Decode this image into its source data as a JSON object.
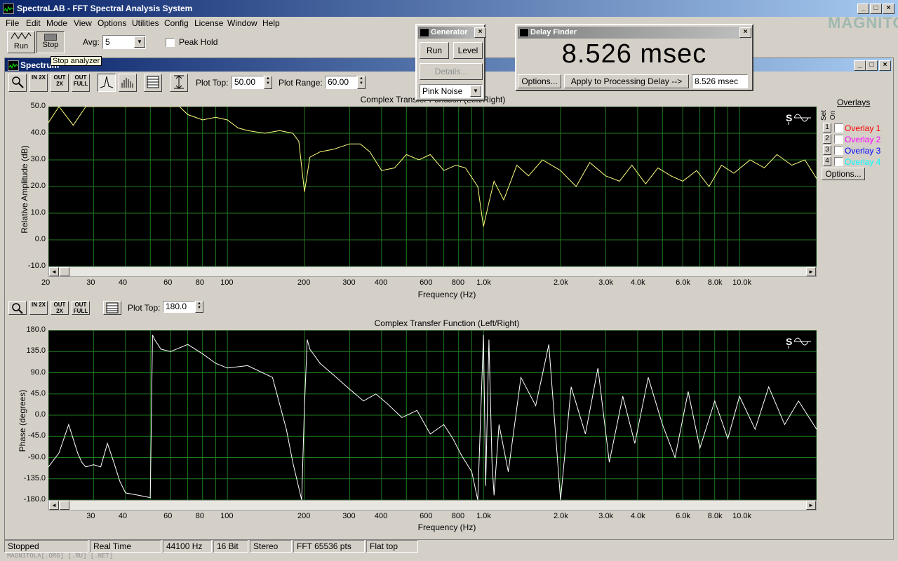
{
  "app": {
    "title": "SpectraLAB - FFT Spectral Analysis System",
    "watermark": "MAGNITOLA"
  },
  "menu": [
    "File",
    "Edit",
    "Mode",
    "View",
    "Options",
    "Utilities",
    "Config",
    "License",
    "Window",
    "Help"
  ],
  "toolbar": {
    "run_label": "Run",
    "stop_label": "Stop",
    "tooltip": "Stop analyzer",
    "avg_label": "Avg:",
    "avg_value": "5",
    "peak_hold_label": "Peak Hold"
  },
  "spectrum_window": {
    "title": "Spectrum",
    "plot_top_label": "Plot Top:",
    "plot_top_value": "50.00",
    "plot_range_label": "Plot Range:",
    "plot_range_value": "60.00",
    "zoom_labels": [
      "IN 2X",
      "OUT 2X",
      "OUT FULL"
    ],
    "phase_plot_top_value": "180.0"
  },
  "overlays": {
    "title": "Overlays",
    "set_label": "Set",
    "on_label": "On",
    "items": [
      {
        "num": "1",
        "label": "Overlay 1",
        "color": "#ff0000"
      },
      {
        "num": "2",
        "label": "Overlay 2",
        "color": "#ff00ff"
      },
      {
        "num": "3",
        "label": "Overlay 3",
        "color": "#0000ff"
      },
      {
        "num": "4",
        "label": "Overlay 4",
        "color": "#00ffff"
      }
    ],
    "options_label": "Options..."
  },
  "generator": {
    "title": "Generator",
    "run_label": "Run",
    "level_label": "Level",
    "details_label": "Details...",
    "signal": "Pink Noise"
  },
  "delay_finder": {
    "title": "Delay Finder",
    "value": "8.526 msec",
    "options_label": "Options...",
    "apply_label": "Apply to Processing Delay -->",
    "field_value": "8.526 msec"
  },
  "status": {
    "cells": [
      "Stopped",
      "Real Time",
      "44100 Hz",
      "16 Bit",
      "Stereo",
      "FFT 65536 pts",
      "Flat top"
    ],
    "footer": "MAGNITOLA[.ORG] [.RU] [.NET]"
  },
  "chart_data": [
    {
      "type": "line",
      "title": "Complex Transfer Function (Left/Right)",
      "xlabel": "Frequency (Hz)",
      "ylabel": "Relative Amplitude (dB)",
      "xscale": "log",
      "xlim": [
        20,
        20000
      ],
      "ylim": [
        -10,
        50
      ],
      "x_ticks": [
        "20",
        "30",
        "40",
        "60",
        "80",
        "100",
        "200",
        "300",
        "400",
        "600",
        "800",
        "1.0k",
        "2.0k",
        "3.0k",
        "4.0k",
        "6.0k",
        "8.0k",
        "10.0k"
      ],
      "y_ticks": [
        "50.0",
        "40.0",
        "30.0",
        "20.0",
        "10.0",
        "0.0",
        "-10.0"
      ],
      "line_color": "#ffff80",
      "grid": true,
      "series": [
        {
          "x": [
            20,
            22,
            25,
            28,
            32,
            35,
            40,
            45,
            50,
            55,
            60,
            65,
            70,
            80,
            90,
            100,
            110,
            120,
            140,
            160,
            180,
            190,
            200,
            210,
            230,
            260,
            300,
            330,
            360,
            400,
            450,
            500,
            560,
            620,
            700,
            780,
            850,
            950,
            1000,
            1050,
            1100,
            1200,
            1350,
            1500,
            1700,
            2000,
            2300,
            2600,
            3000,
            3400,
            3800,
            4300,
            4800,
            5400,
            6000,
            6800,
            7600,
            8500,
            9500,
            11000,
            12500,
            14000,
            16000,
            18000,
            20000
          ],
          "values": [
            44,
            50,
            43,
            50,
            50,
            50,
            50,
            50,
            50,
            50,
            50,
            50,
            47,
            45,
            46,
            45,
            42,
            41,
            40,
            41,
            40,
            37,
            18,
            31,
            33,
            34,
            36,
            36,
            33,
            26,
            27,
            32,
            30,
            32,
            26,
            28,
            27,
            20,
            5,
            14,
            22,
            15,
            28,
            24,
            30,
            26,
            20,
            29,
            24,
            22,
            28,
            21,
            27,
            24,
            22,
            26,
            20,
            28,
            25,
            30,
            27,
            32,
            28,
            30,
            23
          ]
        }
      ]
    },
    {
      "type": "line",
      "title": "Complex Transfer Function (Left/Right)",
      "xlabel": "Frequency (Hz)",
      "ylabel": "Phase (degrees)",
      "xscale": "log",
      "xlim": [
        20,
        20000
      ],
      "ylim": [
        -180,
        180
      ],
      "x_ticks": [
        "30",
        "40",
        "60",
        "80",
        "100",
        "200",
        "300",
        "400",
        "600",
        "800",
        "1.0k",
        "2.0k",
        "3.0k",
        "4.0k",
        "6.0k",
        "8.0k",
        "10.0k"
      ],
      "y_ticks": [
        "180.0",
        "135.0",
        "90.0",
        "45.0",
        "0.0",
        "-45.0",
        "-90.0",
        "-135.0",
        "-180.0"
      ],
      "line_color": "#ffffff",
      "grid": true,
      "series": [
        {
          "x": [
            20,
            22,
            24,
            26,
            27,
            28,
            30,
            32,
            34,
            35,
            36,
            38,
            40,
            45,
            50,
            51,
            52,
            55,
            60,
            70,
            80,
            90,
            100,
            120,
            150,
            170,
            180,
            195,
            200,
            205,
            210,
            230,
            260,
            300,
            340,
            380,
            420,
            480,
            550,
            620,
            700,
            760,
            820,
            900,
            950,
            1000,
            1020,
            1050,
            1080,
            1100,
            1150,
            1250,
            1400,
            1600,
            1800,
            2000,
            2200,
            2500,
            2800,
            3100,
            3500,
            3900,
            4400,
            5000,
            5600,
            6300,
            7000,
            8000,
            9000,
            10000,
            11500,
            13000,
            15000,
            17000,
            20000
          ],
          "values": [
            -110,
            -80,
            -20,
            -80,
            -100,
            -110,
            -105,
            -110,
            -60,
            -80,
            -100,
            -140,
            -165,
            -170,
            -175,
            170,
            160,
            140,
            135,
            150,
            130,
            110,
            100,
            105,
            80,
            -30,
            -100,
            -180,
            20,
            160,
            140,
            110,
            85,
            55,
            30,
            45,
            25,
            -5,
            10,
            -40,
            -20,
            -50,
            -85,
            -120,
            -180,
            170,
            -150,
            160,
            -100,
            -170,
            -20,
            -120,
            80,
            20,
            150,
            -180,
            60,
            -40,
            100,
            -100,
            40,
            -60,
            80,
            -20,
            -90,
            50,
            -70,
            30,
            -50,
            40,
            -30,
            60,
            -20,
            30,
            -30
          ]
        }
      ]
    }
  ]
}
